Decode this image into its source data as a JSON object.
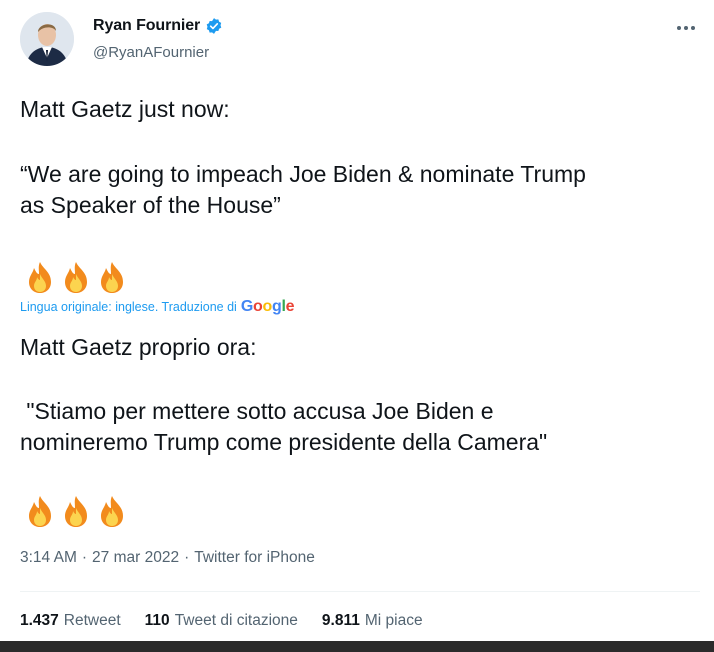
{
  "author": {
    "display_name": "Ryan Fournier",
    "handle": "@RyanAFournier",
    "verified": true
  },
  "tweet": {
    "line1": "Matt Gaetz just now:",
    "line2": "“We are going to impeach Joe Biden & nominate Trump\nas Speaker of the House”",
    "emoji": "fire-icon",
    "emoji_count": 3
  },
  "translation": {
    "notice": "Lingua originale: inglese. Traduzione di",
    "provider": "Google",
    "line1": "Matt Gaetz proprio ora:",
    "line2": " \"Stiamo per mettere sotto accusa Joe Biden e\nnomineremo Trump come presidente della Camera\""
  },
  "meta": {
    "time": "3:14 AM",
    "date": "27 mar 2022",
    "source": "Twitter for iPhone",
    "separator": "·"
  },
  "stats": {
    "retweets_count": "1.437",
    "retweets_label": "Retweet",
    "quotes_count": "110",
    "quotes_label": "Tweet di citazione",
    "likes_count": "9.811",
    "likes_label": "Mi piace"
  },
  "colors": {
    "accent": "#1d9bf0",
    "text": "#0f1419",
    "muted": "#536471"
  }
}
